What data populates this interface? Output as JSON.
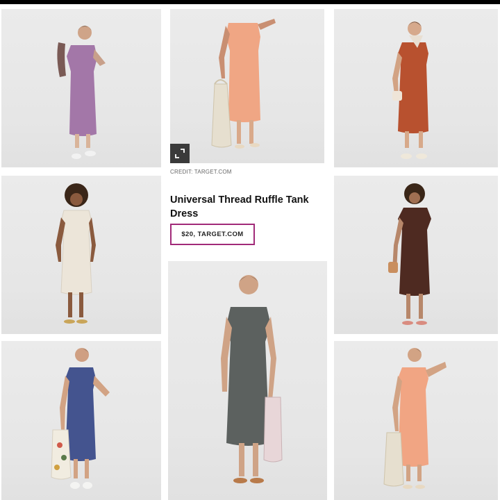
{
  "article": {
    "credit": "CREDIT: TARGET.COM",
    "product_title": "Universal Thread Ruffle Tank Dress",
    "buy_button": "$20, TARGET.COM",
    "accent_color": "#a12a79"
  },
  "photos": [
    {
      "id": "lavender",
      "color": "#a377a8",
      "icon": "expand-icon"
    },
    {
      "id": "peach-tote",
      "color": "#f0a684"
    },
    {
      "id": "rust",
      "color": "#b8512f"
    },
    {
      "id": "cream",
      "color": "#ece5d9"
    },
    {
      "id": "brown",
      "color": "#4e2a21"
    },
    {
      "id": "blue",
      "color": "#44548f"
    },
    {
      "id": "charcoal",
      "color": "#5c615f"
    },
    {
      "id": "peach-smile",
      "color": "#f1a583"
    }
  ]
}
